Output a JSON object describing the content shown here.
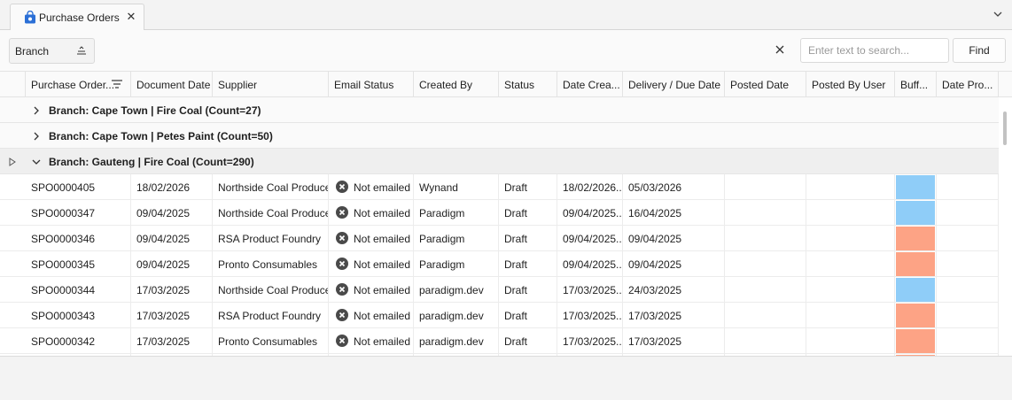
{
  "tab": {
    "label": "Purchase Orders",
    "close_glyph": "✕",
    "icon": "shopping-bag-icon"
  },
  "toolbar": {
    "group_chip_label": "Branch",
    "search_placeholder": "Enter text to search...",
    "search_value": "",
    "find_label": "Find"
  },
  "columns": [
    "Purchase Order...",
    "Document Date",
    "Supplier",
    "Email Status",
    "Created By",
    "Status",
    "Date Crea...",
    "Delivery / Due Date",
    "Posted Date",
    "Posted By User",
    "Buff...",
    "Date Pro..."
  ],
  "groups": [
    {
      "label": "Branch: Cape Town | Fire Coal (Count=27)",
      "expanded": false
    },
    {
      "label": "Branch: Cape Town | Petes Paint (Count=50)",
      "expanded": false
    },
    {
      "label": "Branch: Gauteng | Fire Coal (Count=290)",
      "expanded": true
    }
  ],
  "rows": [
    {
      "po": "SPO0000405",
      "doc_date": "18/02/2026",
      "supplier": "Northside Coal Producers",
      "email_status": "Not emailed",
      "created_by": "Wynand",
      "status": "Draft",
      "date_created": "18/02/2026...",
      "due_date": "05/03/2026",
      "posted_date": "",
      "posted_by": "",
      "buffer": "blue",
      "date_pro": ""
    },
    {
      "po": "SPO0000347",
      "doc_date": "09/04/2025",
      "supplier": "Northside Coal Producers",
      "email_status": "Not emailed",
      "created_by": "Paradigm",
      "status": "Draft",
      "date_created": "09/04/2025...",
      "due_date": "16/04/2025",
      "posted_date": "",
      "posted_by": "",
      "buffer": "blue",
      "date_pro": ""
    },
    {
      "po": "SPO0000346",
      "doc_date": "09/04/2025",
      "supplier": "RSA Product Foundry",
      "email_status": "Not emailed",
      "created_by": "Paradigm",
      "status": "Draft",
      "date_created": "09/04/2025...",
      "due_date": "09/04/2025",
      "posted_date": "",
      "posted_by": "",
      "buffer": "orange",
      "date_pro": ""
    },
    {
      "po": "SPO0000345",
      "doc_date": "09/04/2025",
      "supplier": "Pronto Consumables",
      "email_status": "Not emailed",
      "created_by": "Paradigm",
      "status": "Draft",
      "date_created": "09/04/2025...",
      "due_date": "09/04/2025",
      "posted_date": "",
      "posted_by": "",
      "buffer": "orange",
      "date_pro": ""
    },
    {
      "po": "SPO0000344",
      "doc_date": "17/03/2025",
      "supplier": "Northside Coal Producers",
      "email_status": "Not emailed",
      "created_by": "paradigm.dev",
      "status": "Draft",
      "date_created": "17/03/2025...",
      "due_date": "24/03/2025",
      "posted_date": "",
      "posted_by": "",
      "buffer": "blue",
      "date_pro": ""
    },
    {
      "po": "SPO0000343",
      "doc_date": "17/03/2025",
      "supplier": "RSA Product Foundry",
      "email_status": "Not emailed",
      "created_by": "paradigm.dev",
      "status": "Draft",
      "date_created": "17/03/2025...",
      "due_date": "17/03/2025",
      "posted_date": "",
      "posted_by": "",
      "buffer": "orange",
      "date_pro": ""
    },
    {
      "po": "SPO0000342",
      "doc_date": "17/03/2025",
      "supplier": "Pronto Consumables",
      "email_status": "Not emailed",
      "created_by": "paradigm.dev",
      "status": "Draft",
      "date_created": "17/03/2025...",
      "due_date": "17/03/2025",
      "posted_date": "",
      "posted_by": "",
      "buffer": "orange",
      "date_pro": ""
    },
    {
      "po": "",
      "doc_date": "",
      "supplier": "",
      "email_status": "",
      "created_by": "",
      "status": "",
      "date_created": "",
      "due_date": "",
      "posted_date": "",
      "posted_by": "",
      "buffer": "orange",
      "date_pro": ""
    }
  ],
  "colors": {
    "buffer_blue": "#8fcdf8",
    "buffer_orange": "#fda385",
    "accent": "#2b6fd6",
    "email_icon": "#4a4a4a"
  },
  "icons": {
    "expand": "chevron-right-icon",
    "collapse": "chevron-down-icon",
    "email_status": "x-circle-icon",
    "row_indicator": "caret-right-icon",
    "header_filter": "filter-icon",
    "sort": "sort-icon",
    "clear": "close-icon"
  }
}
